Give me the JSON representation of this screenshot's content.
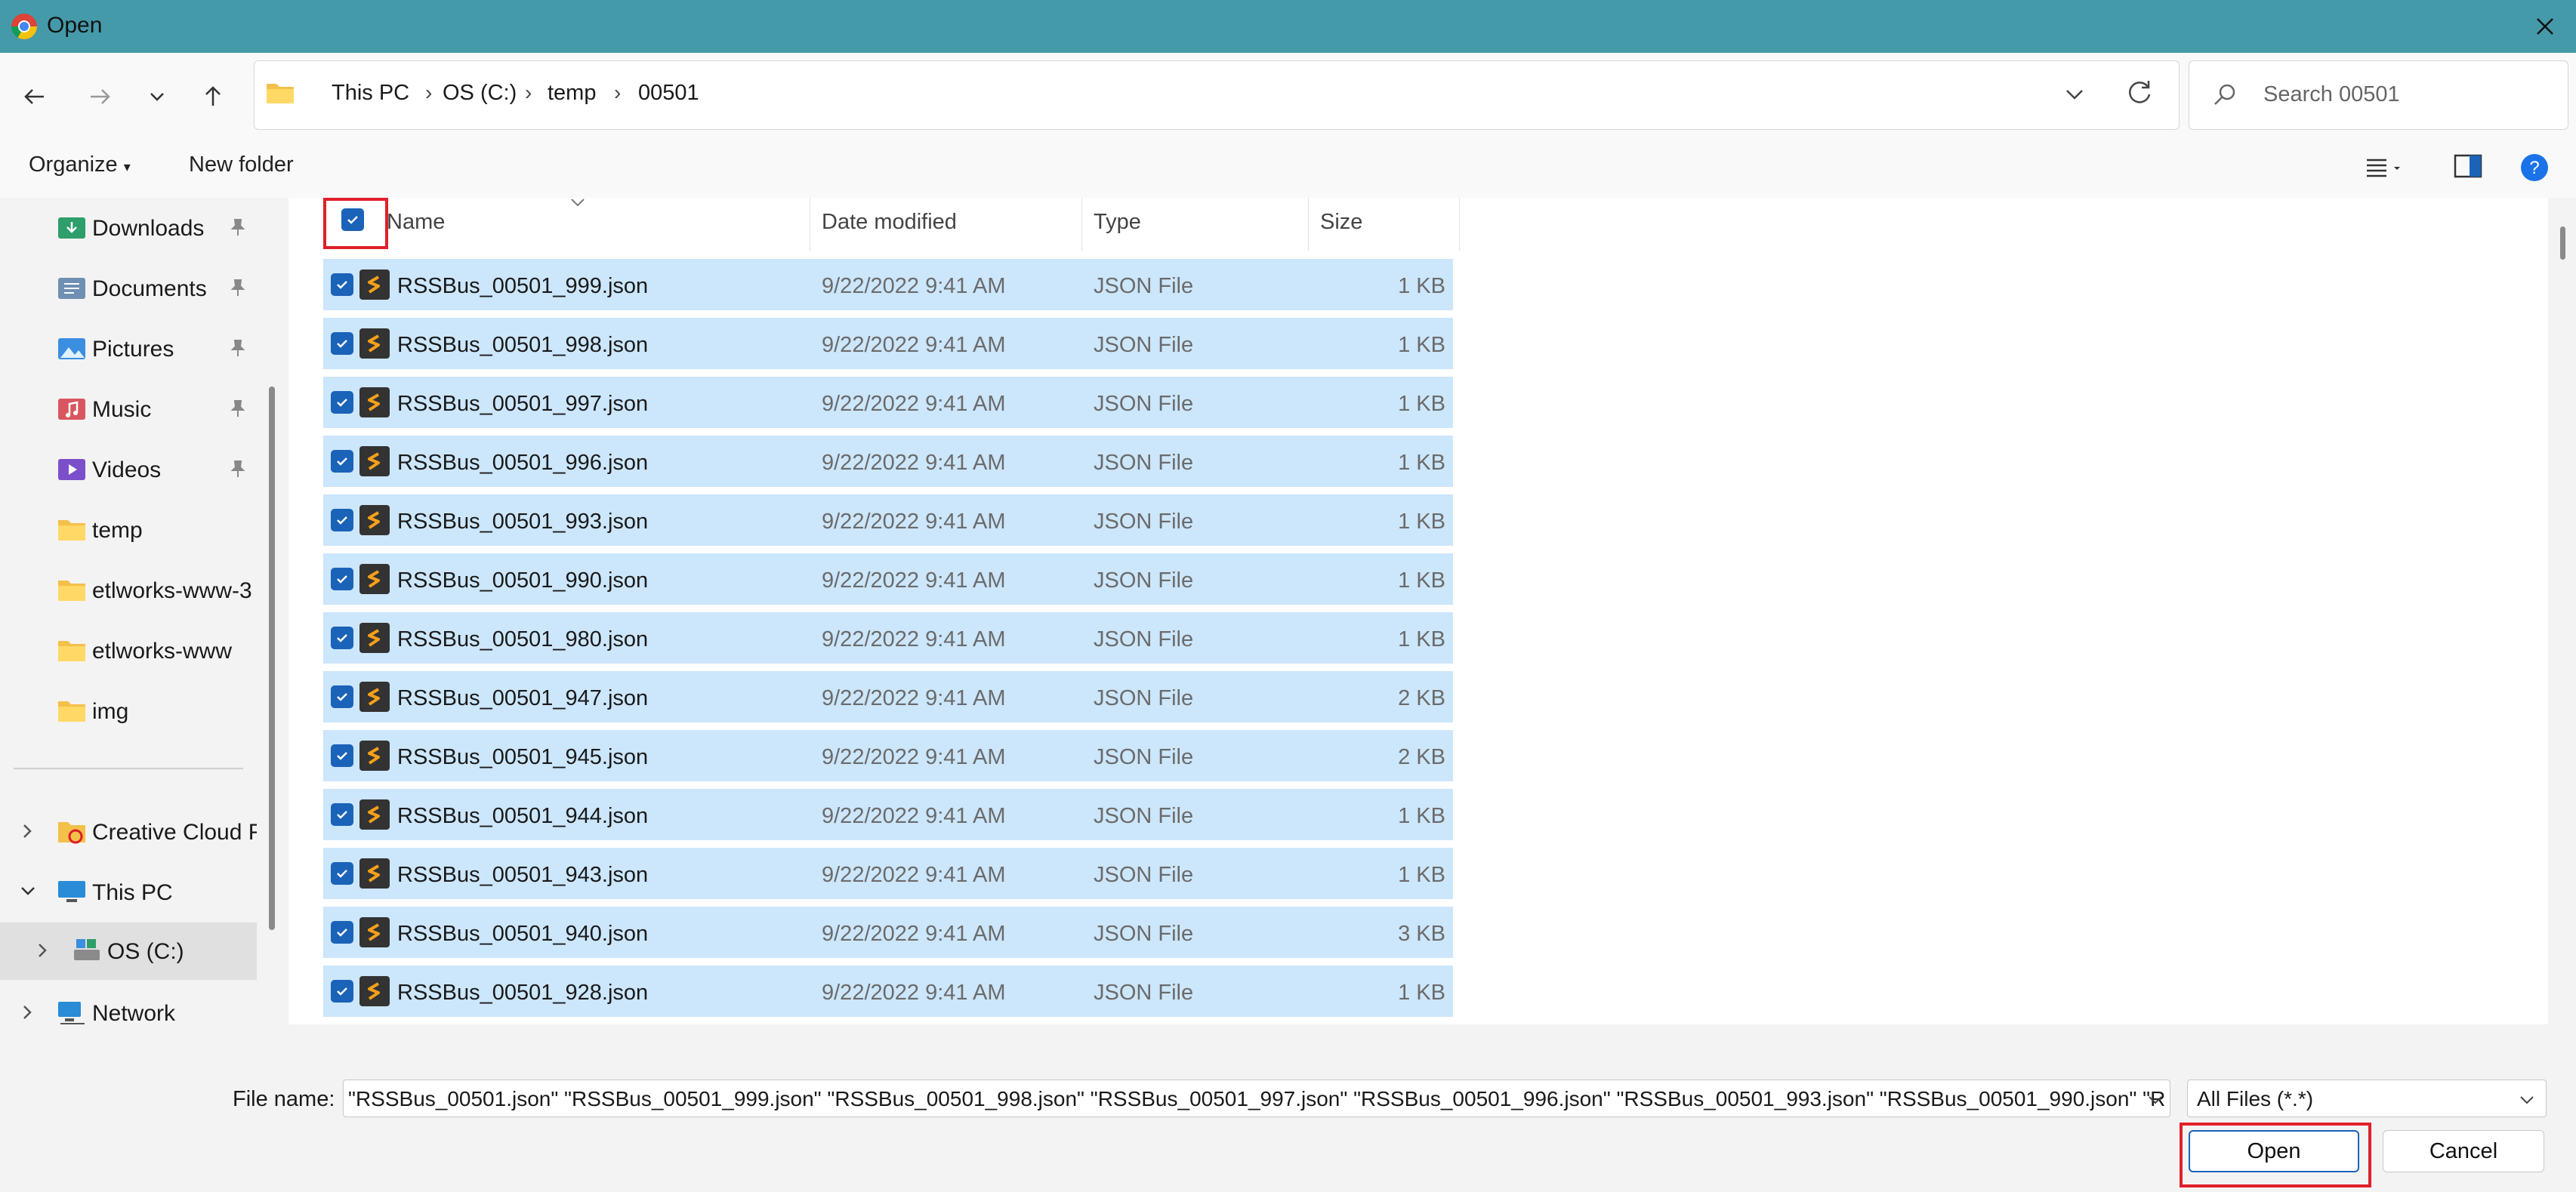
{
  "window": {
    "title": "Open"
  },
  "address": {
    "crumbs": [
      "This PC",
      "OS (C:)",
      "temp",
      "00501"
    ]
  },
  "search": {
    "placeholder": "Search 00501"
  },
  "toolbar": {
    "organize": "Organize",
    "new_folder": "New folder"
  },
  "sidebar": {
    "items": [
      {
        "label": "Downloads",
        "icon": "download-folder-icon",
        "pinned": true
      },
      {
        "label": "Documents",
        "icon": "documents-icon",
        "pinned": true
      },
      {
        "label": "Pictures",
        "icon": "pictures-icon",
        "pinned": true
      },
      {
        "label": "Music",
        "icon": "music-icon",
        "pinned": true
      },
      {
        "label": "Videos",
        "icon": "videos-icon",
        "pinned": true
      },
      {
        "label": "temp",
        "icon": "folder-icon",
        "pinned": false
      },
      {
        "label": "etlworks-www-3",
        "icon": "folder-icon",
        "pinned": false
      },
      {
        "label": "etlworks-www",
        "icon": "folder-icon",
        "pinned": false
      },
      {
        "label": "img",
        "icon": "folder-icon",
        "pinned": false
      }
    ],
    "tree": [
      {
        "label": "Creative Cloud F",
        "icon": "creative-cloud-icon"
      },
      {
        "label": "This PC",
        "icon": "pc-icon"
      },
      {
        "label": "OS (C:)",
        "icon": "drive-icon"
      },
      {
        "label": "Network",
        "icon": "network-icon"
      }
    ]
  },
  "columns": {
    "name": "Name",
    "date": "Date modified",
    "type": "Type",
    "size": "Size"
  },
  "files": [
    {
      "name": "RSSBus_00501_999.json",
      "date": "9/22/2022 9:41 AM",
      "type": "JSON File",
      "size": "1 KB"
    },
    {
      "name": "RSSBus_00501_998.json",
      "date": "9/22/2022 9:41 AM",
      "type": "JSON File",
      "size": "1 KB"
    },
    {
      "name": "RSSBus_00501_997.json",
      "date": "9/22/2022 9:41 AM",
      "type": "JSON File",
      "size": "1 KB"
    },
    {
      "name": "RSSBus_00501_996.json",
      "date": "9/22/2022 9:41 AM",
      "type": "JSON File",
      "size": "1 KB"
    },
    {
      "name": "RSSBus_00501_993.json",
      "date": "9/22/2022 9:41 AM",
      "type": "JSON File",
      "size": "1 KB"
    },
    {
      "name": "RSSBus_00501_990.json",
      "date": "9/22/2022 9:41 AM",
      "type": "JSON File",
      "size": "1 KB"
    },
    {
      "name": "RSSBus_00501_980.json",
      "date": "9/22/2022 9:41 AM",
      "type": "JSON File",
      "size": "1 KB"
    },
    {
      "name": "RSSBus_00501_947.json",
      "date": "9/22/2022 9:41 AM",
      "type": "JSON File",
      "size": "2 KB"
    },
    {
      "name": "RSSBus_00501_945.json",
      "date": "9/22/2022 9:41 AM",
      "type": "JSON File",
      "size": "2 KB"
    },
    {
      "name": "RSSBus_00501_944.json",
      "date": "9/22/2022 9:41 AM",
      "type": "JSON File",
      "size": "1 KB"
    },
    {
      "name": "RSSBus_00501_943.json",
      "date": "9/22/2022 9:41 AM",
      "type": "JSON File",
      "size": "1 KB"
    },
    {
      "name": "RSSBus_00501_940.json",
      "date": "9/22/2022 9:41 AM",
      "type": "JSON File",
      "size": "3 KB"
    },
    {
      "name": "RSSBus_00501_928.json",
      "date": "9/22/2022 9:41 AM",
      "type": "JSON File",
      "size": "1 KB"
    }
  ],
  "footer": {
    "file_name_label": "File name:",
    "file_name_value": "\"RSSBus_00501.json\" \"RSSBus_00501_999.json\" \"RSSBus_00501_998.json\" \"RSSBus_00501_997.json\" \"RSSBus_00501_996.json\" \"RSSBus_00501_993.json\" \"RSSBus_00501_990.json\" \"R",
    "file_type": "All Files (*.*)",
    "open": "Open",
    "cancel": "Cancel"
  },
  "colors": {
    "titlebar": "#459aaa",
    "selection": "#cce6fb",
    "accent": "#1a63b8",
    "highlight": "#e0202a"
  }
}
